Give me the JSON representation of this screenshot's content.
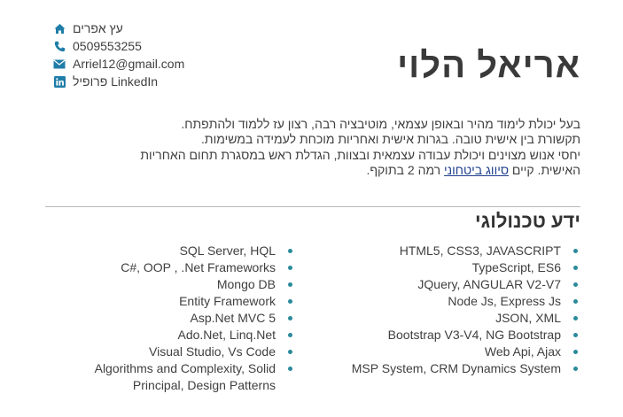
{
  "colors": {
    "accent": "#1f7da8",
    "bullet": "#2a8a9a",
    "text": "#3f3f3f",
    "heading": "#3a3a3a",
    "link": "#1f3f8f"
  },
  "contact": {
    "address": {
      "icon": "home-icon",
      "text": "עץ אפרים"
    },
    "phone": {
      "icon": "phone-icon",
      "text": "0509553255"
    },
    "email": {
      "icon": "envelope-icon",
      "text": "Arriel12@gmail.com"
    },
    "linkedin": {
      "icon": "linkedin-icon",
      "text": "LinkedIn פרופיל"
    }
  },
  "name": "אריאל הלוי",
  "summary": {
    "line1": "בעל יכולת לימוד מהיר ובאופן עצמאי, מוטיבציה רבה, רצון עז ללמוד ולהתפתח.",
    "line2": "תקשורת בין אישית טובה. בגרות אישית ואחריות מוכחת לעמידה במשימות.",
    "line3": "יחסי אנוש מצוינים ויכולת עבודה עצמאית ובצוות, הגדלת ראש במסגרת תחום האחריות",
    "line4_prefix": "האישית. קיים",
    "line4_link": "סיווג ביטחוני",
    "line4_suffix": "רמה 2 בתוקף."
  },
  "skills_section": {
    "title": "ידע טכנולוגי",
    "right_column": [
      "HTML5, CSS3, JAVASCRIPT",
      "TypeScript, ES6",
      "JQuery, ANGULAR V2-V7",
      "Node Js, Express Js",
      "JSON, XML",
      "Bootstrap V3-V4, NG Bootstrap",
      "Web Api, Ajax",
      "MSP System, CRM Dynamics System"
    ],
    "left_column": [
      "SQL Server, HQL",
      "C#, OOP , .Net Frameworks",
      "Mongo DB",
      "Entity Framework",
      "Asp.Net MVC 5",
      "Ado.Net, Linq.Net",
      "Visual Studio, Vs Code",
      "Algorithms and Complexity, Solid Principal, Design Patterns"
    ]
  }
}
